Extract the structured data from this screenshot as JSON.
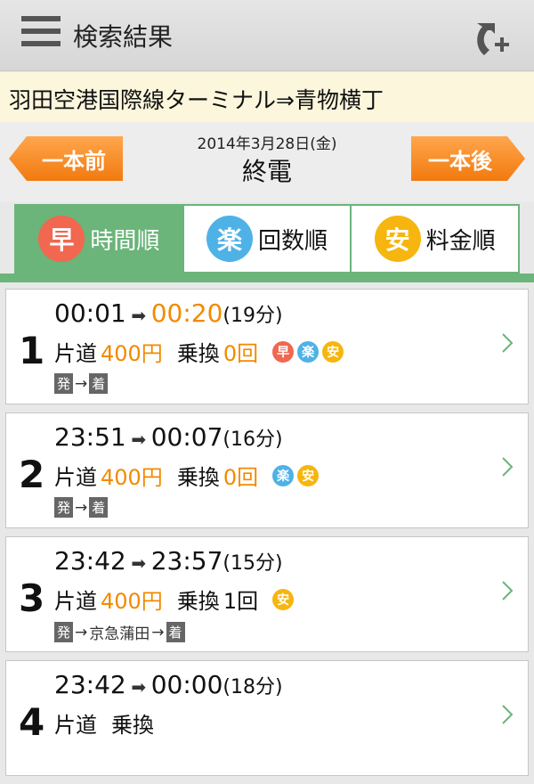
{
  "header": {
    "title": "検索結果",
    "menu_icon": "hamburger-icon",
    "action_icon": "add-route-icon"
  },
  "route": {
    "text": "羽田空港国際線ターミナル⇒青物横丁"
  },
  "nav": {
    "date": "2014年3月28日(金)",
    "status": "終電",
    "prev_label": "一本前",
    "next_label": "一本後"
  },
  "tabs": [
    {
      "badge": "早",
      "label": "時間順",
      "color": "#f1674f"
    },
    {
      "badge": "楽",
      "label": "回数順",
      "color": "#4fb2e6"
    },
    {
      "badge": "安",
      "label": "料金順",
      "color": "#f6b60f"
    }
  ],
  "results": [
    {
      "rank": "1",
      "dep": "00:01",
      "arr": "00:20",
      "duration": "(19分)",
      "fare_label": "片道",
      "fare": "400円",
      "transfer_label": "乗換",
      "transfers": "0回",
      "badges": [
        "早",
        "楽",
        "安"
      ],
      "path_start": "発",
      "path_mid": "",
      "path_end": "着"
    },
    {
      "rank": "2",
      "dep": "23:51",
      "arr": "00:07",
      "duration": "(16分)",
      "fare_label": "片道",
      "fare": "400円",
      "transfer_label": "乗換",
      "transfers": "0回",
      "badges": [
        "楽",
        "安"
      ],
      "path_start": "発",
      "path_mid": "",
      "path_end": "着"
    },
    {
      "rank": "3",
      "dep": "23:42",
      "arr": "23:57",
      "duration": "(15分)",
      "fare_label": "片道",
      "fare": "400円",
      "transfer_label": "乗換",
      "transfers": "1回",
      "badges": [
        "安"
      ],
      "path_start": "発",
      "path_mid": "京急蒲田",
      "path_end": "着"
    },
    {
      "rank": "4",
      "dep": "23:42",
      "arr": "00:00",
      "duration": "(18分)",
      "fare_label": "片道",
      "fare": "",
      "transfer_label": "乗換",
      "transfers": "",
      "badges": [],
      "path_start": "",
      "path_mid": "",
      "path_end": ""
    }
  ],
  "colors": {
    "accent_green": "#6bb47a",
    "orange": "#f18a00",
    "badge_fast": "#f1674f",
    "badge_easy": "#4fb2e6",
    "badge_cheap": "#f6b60f"
  }
}
